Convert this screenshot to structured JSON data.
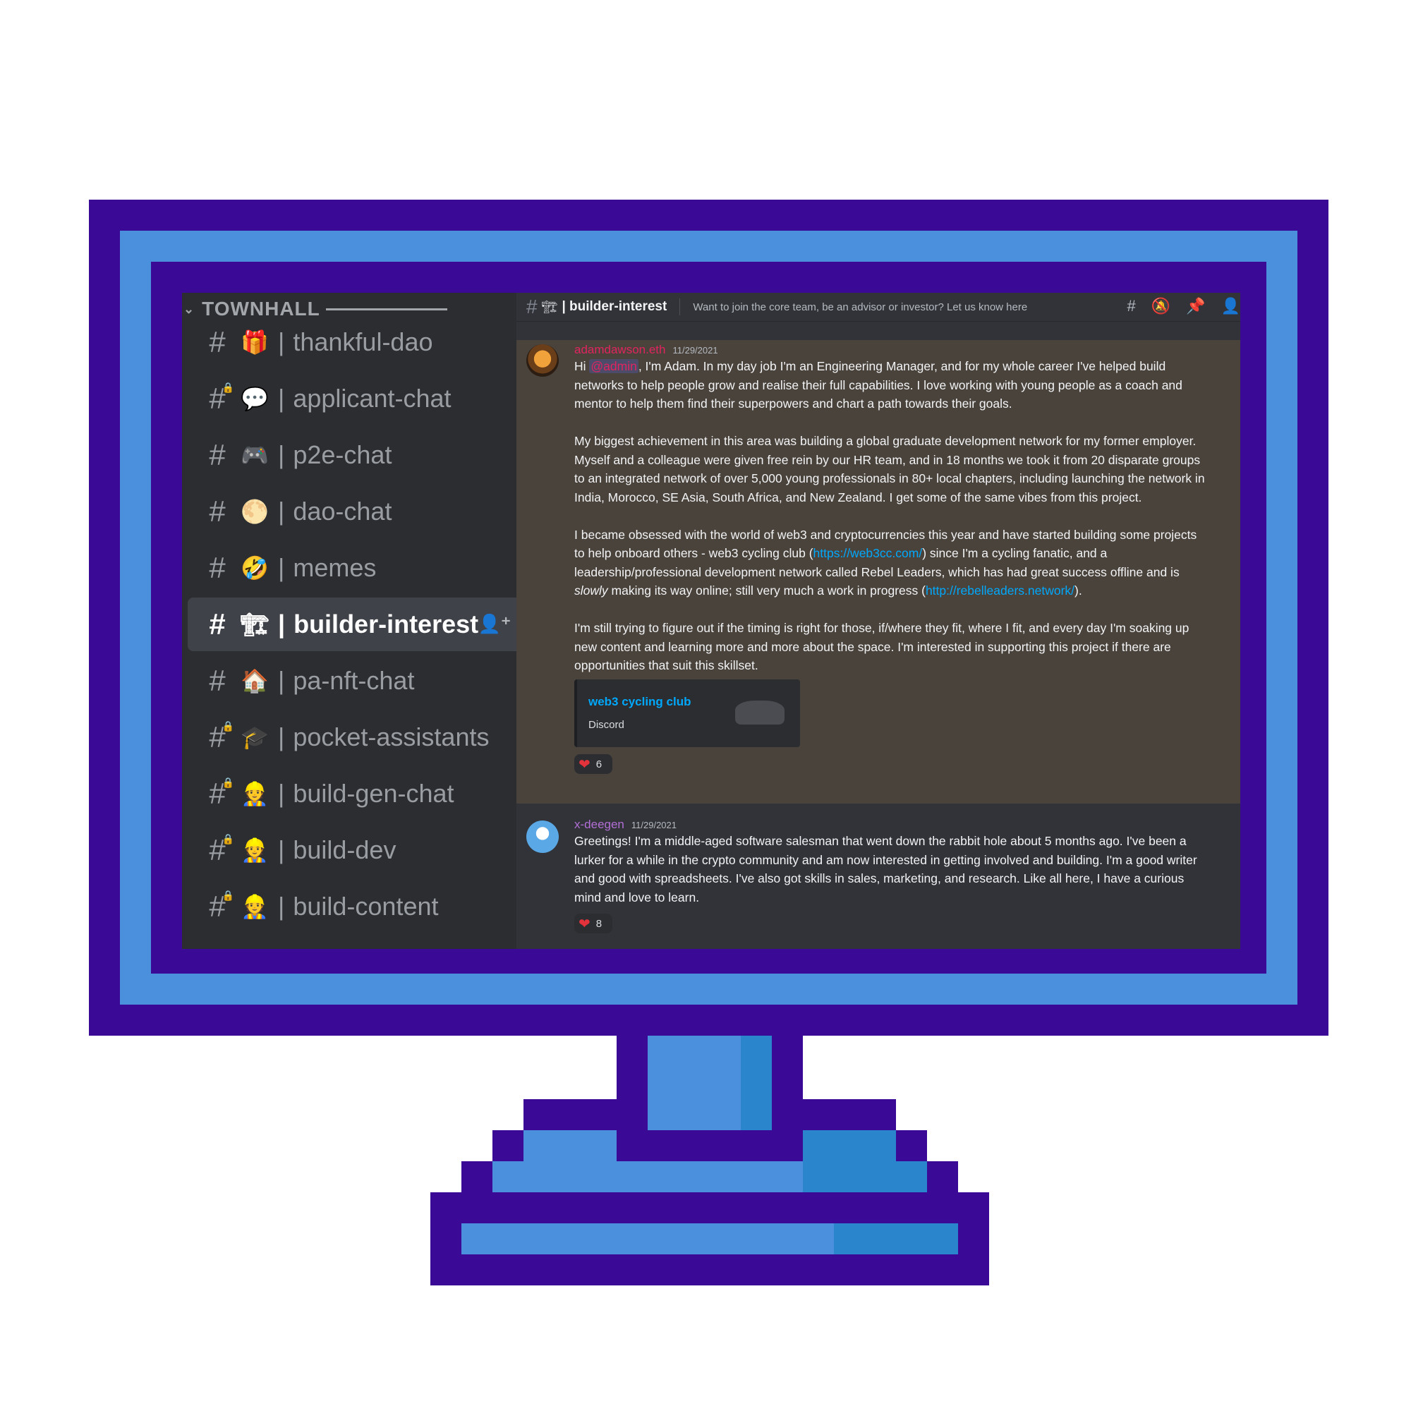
{
  "sidebar": {
    "category": "TOWNHALL",
    "channels": [
      {
        "emoji": "🎁",
        "name": "thankful-dao",
        "locked": false,
        "active": false
      },
      {
        "emoji": "💬",
        "name": "applicant-chat",
        "locked": true,
        "active": false
      },
      {
        "emoji": "🎮",
        "name": "p2e-chat",
        "locked": false,
        "active": false
      },
      {
        "emoji": "🌕",
        "name": "dao-chat",
        "locked": false,
        "active": false
      },
      {
        "emoji": "🤣",
        "name": "memes",
        "locked": false,
        "active": false
      },
      {
        "emoji": "🏗",
        "name": "builder-interest",
        "locked": false,
        "active": true
      },
      {
        "emoji": "🏠",
        "name": "pa-nft-chat",
        "locked": false,
        "active": false
      },
      {
        "emoji": "🎓",
        "name": "pocket-assistants",
        "locked": true,
        "active": false
      },
      {
        "emoji": "👷",
        "name": "build-gen-chat",
        "locked": true,
        "active": false
      },
      {
        "emoji": "👷",
        "name": "build-dev",
        "locked": true,
        "active": false
      },
      {
        "emoji": "👷",
        "name": "build-content",
        "locked": true,
        "active": false
      }
    ]
  },
  "header": {
    "hash": "#",
    "emoji": "🏗",
    "name": "| builder-interest",
    "topic": "Want to join the core team, be an advisor or investor? Let us know here"
  },
  "messages": [
    {
      "author": "adamdawson.eth",
      "timestamp": "11/29/2021",
      "p1_pre": "Hi ",
      "mention": "@admin",
      "p1_post": ", I'm Adam. In my day job I'm an Engineering Manager, and for my whole career I've helped build networks to help people grow and realise their full capabilities. I love working with young people as a coach and mentor to help them find their superpowers and chart a path towards their goals.",
      "p2": "My biggest achievement in this area was building a global graduate development network for my former employer. Myself and a colleague were given free rein by our HR team, and in 18 months we took it from 20 disparate groups to an integrated network of over 5,000 young professionals in 80+ local chapters, including launching the network in India, Morocco, SE Asia, South Africa, and New Zealand. I get some of the same vibes from this project.",
      "p3_a": "I became obsessed with the world of web3 and cryptocurrencies this year and have started building some projects to help onboard others - web3 cycling club (",
      "link1": "https://web3cc.com/",
      "p3_b": ") since I'm a cycling fanatic, and a leadership/professional development network called Rebel Leaders, which has had great success offline and is ",
      "p3_em": "slowly",
      "p3_c": " making its way online; still very much a work in progress (",
      "link2": "http://rebelleaders.network/",
      "p3_d": ").",
      "p4": "I'm still trying to figure out if the timing is right for those, if/where they fit, where I fit, and every day I'm soaking up new content and learning more and more about the space. I'm interested in supporting this project if there are opportunities that suit this skillset.",
      "embed_title": "web3 cycling club",
      "embed_provider": "Discord",
      "reaction_count": "6"
    },
    {
      "author": "x-deegen",
      "timestamp": "11/29/2021",
      "body": "Greetings! I'm a middle-aged software salesman that went down the rabbit hole about 5 months ago. I've been a lurker for a while in the crypto community and am now interested in getting involved and building. I'm a good writer and good with spreadsheets. I've also got skills in sales, marketing, and research. Like all here, I have a curious mind and love to learn.",
      "reaction_count": "8"
    }
  ],
  "colors": {
    "frame": "#3a0a96",
    "frame_accent": "#4a90dd",
    "highlight_bg": "#4a433c",
    "link": "#00a8fc",
    "mention": "#e0245e"
  }
}
